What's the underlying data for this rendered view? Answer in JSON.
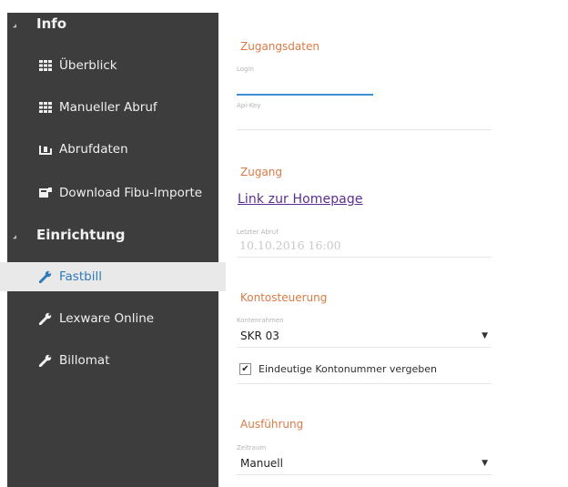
{
  "sidebar": {
    "sections": [
      {
        "label": "Info",
        "caret": "⌟"
      },
      {
        "label": "Einrichtung",
        "caret": "⌟"
      }
    ],
    "items": [
      {
        "label": "Überblick",
        "icon": "grid-icon"
      },
      {
        "label": "Manueller Abruf",
        "icon": "grid-icon"
      },
      {
        "label": "Abrufdaten",
        "icon": "inbox-icon"
      },
      {
        "label": "Download Fibu-Importe",
        "icon": "download-icon"
      },
      {
        "label": "Fastbill",
        "icon": "wrench-icon",
        "active": true
      },
      {
        "label": "Lexware Online",
        "icon": "wrench-icon"
      },
      {
        "label": "Billomat",
        "icon": "wrench-icon"
      }
    ]
  },
  "main": {
    "zugangsdaten": {
      "title": "Zugangsdaten",
      "login_label": "Login",
      "apikey_label": "Api-Key"
    },
    "zugang": {
      "title": "Zugang",
      "link_text": "Link zur Homepage",
      "last_fetch_label": "Letzter Abruf",
      "last_fetch_value": "10.10.2016 16:00"
    },
    "kontosteuerung": {
      "title": "Kontosteuerung",
      "kontenrahmen_label": "Kontenrahmen",
      "kontenrahmen_value": "SKR 03",
      "checkbox_label": "Eindeutige Kontonummer vergeben",
      "checkbox_checked": true
    },
    "ausfuehrung": {
      "title": "Ausführung",
      "zeitraum_label": "Zeitraum",
      "zeitraum_value": "Manuell"
    }
  },
  "colors": {
    "sidebar_bg": "#3d3d3d",
    "active_bg": "#e9e9e9",
    "active_text": "#2f7ab8",
    "section_title": "#d97a45",
    "link": "#5b2d91",
    "focus_line": "#3f8ccf"
  }
}
